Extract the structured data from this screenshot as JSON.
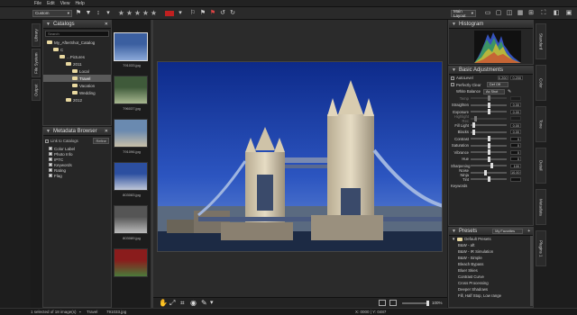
{
  "menu": [
    "File",
    "Edit",
    "View",
    "Help"
  ],
  "toolbar": {
    "preset_dropdown": "Custom",
    "layout_dropdown": "Main Layout",
    "stars": [
      "★",
      "★",
      "★",
      "★",
      "★"
    ]
  },
  "left_vtabs": [
    "Library",
    "File System",
    "Output"
  ],
  "catalogs": {
    "title": "Catalogs",
    "search_placeholder": "Search",
    "tree": [
      {
        "label": "My_AfterShot_Catalog",
        "indent": 0
      },
      {
        "label": "C",
        "indent": 1
      },
      {
        "label": "...Pictures",
        "indent": 2
      },
      {
        "label": "2011",
        "indent": 3
      },
      {
        "label": "Local",
        "indent": 4
      },
      {
        "label": "Travel",
        "indent": 4,
        "selected": true
      },
      {
        "label": "Vacation",
        "indent": 4
      },
      {
        "label": "Wedding",
        "indent": 4
      },
      {
        "label": "2012",
        "indent": 3
      }
    ]
  },
  "metadata": {
    "title": "Metadata Browser",
    "link_label": "Link to Catalogs",
    "refine_button": "Refine",
    "items": [
      "Color Label",
      "Photo Info",
      "IPTC",
      "Keywords",
      "Rating",
      "Flag"
    ]
  },
  "filmstrip": [
    {
      "caption": "791033.jpg",
      "color1": "#3b5fa0",
      "color2": "#8aa8d8"
    },
    {
      "caption": "796037.jpg",
      "color1": "#3f5a3a",
      "color2": "#a8b890"
    },
    {
      "caption": "791096.jpg",
      "color1": "#6a8ab0",
      "color2": "#c8c0a8"
    },
    {
      "caption": "803083.jpg",
      "color1": "#2c4fa0",
      "color2": "#c0c8d8"
    },
    {
      "caption": "803089.jpg",
      "color1": "#555",
      "color2": "#bbb"
    },
    {
      "caption": "",
      "color1": "#8a1c1c",
      "color2": "#4a7a3a"
    }
  ],
  "histogram": {
    "title": "Histogram"
  },
  "basic_adjustments": {
    "title": "Basic Adjustments",
    "autolevel": {
      "label": "AutoLevel",
      "v1": "0.200",
      "v2": "0.200"
    },
    "perfectly_clear": {
      "label": "Perfectly Clear",
      "value": "Def Off"
    },
    "white_balance": {
      "label": "White Balance",
      "value": "As Shot"
    },
    "rows": [
      {
        "label": "Temp",
        "value": "",
        "knob": 0.5,
        "dim": true
      },
      {
        "label": "Straighten",
        "value": "0.00",
        "knob": 0.5
      },
      {
        "label": "Exposure",
        "value": "0.00",
        "knob": 0.5
      },
      {
        "label": "Highlight Rec",
        "value": "",
        "knob": 0.1,
        "dim": true
      },
      {
        "label": "Fill Light",
        "value": "0.00",
        "knob": 0.05
      },
      {
        "label": "Blacks",
        "value": "0.00",
        "knob": 0.05
      },
      {
        "label": "Contrast",
        "value": "0",
        "knob": 0.5
      },
      {
        "label": "Saturation",
        "value": "0",
        "knob": 0.5
      },
      {
        "label": "Vibrance",
        "value": "0",
        "knob": 0.5
      },
      {
        "label": "Hue",
        "value": "0",
        "knob": 0.5
      },
      {
        "label": "Sharpening",
        "value": "100",
        "knob": 0.6
      },
      {
        "label": "Noise Ninja",
        "value": "10.00",
        "knob": 0.4
      },
      {
        "label": "Tint",
        "value": "",
        "knob": 0.5
      }
    ],
    "keywords_label": "Keywords"
  },
  "presets": {
    "title": "Presets",
    "dropdown": "My Favorites",
    "folder": "Default Presets",
    "items": [
      "B&W - aft",
      "B&W - IR Simulation",
      "B&W - Simple",
      "Bleach Bypass",
      "Bluer Skies",
      "Contrast Curve",
      "Cross Processing",
      "Deeper Shadows",
      "Fill, Half Stop, Low range"
    ]
  },
  "right_vtabs": [
    "Standard",
    "Color",
    "Tone",
    "Detail",
    "Metadata",
    "Plugins 1"
  ],
  "bottom": {
    "zoom": "100%"
  },
  "status": {
    "selection": "1 selected of 18 image(s)",
    "folder": "Travel",
    "file": "791033.jpg",
    "coords": "X: 0000 | Y: 0487"
  }
}
